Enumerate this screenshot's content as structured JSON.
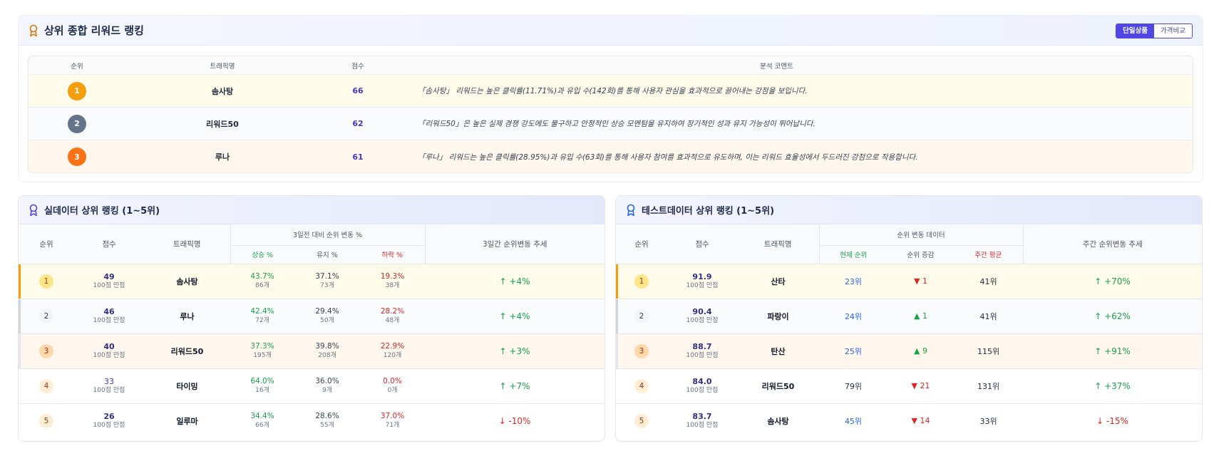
{
  "top": {
    "title": "상위 종합 리워드 랭킹",
    "toggle": [
      "단일상품",
      "가격비교"
    ],
    "headers": {
      "rank": "순위",
      "name": "트래픽명",
      "score": "점수",
      "comment": "분석 코멘트"
    },
    "rows": [
      {
        "rank": "1",
        "name": "솜사탕",
        "score": "66",
        "comment": "「솜사탕」 리워드는 높은 클릭률(11.71%)과 유입 수(142회)를 통해 사용자 관심을 효과적으로 끌어내는 강점을 보입니다."
      },
      {
        "rank": "2",
        "name": "리워드50",
        "score": "62",
        "comment": "「리워드50」은 높은 실제 경쟁 강도에도 불구하고 안정적인 상승 모멘텀을 유지하여 장기적인 성과 유지 가능성이 뛰어납니다."
      },
      {
        "rank": "3",
        "name": "루나",
        "score": "61",
        "comment": "「루나」 리워드는 높은 클릭률(28.95%)과 유입 수(63회)를 통해 사용자 참여를 효과적으로 유도하며, 이는 리워드 효율성에서 두드러진 강점으로 작용합니다."
      }
    ],
    "medal_colors": [
      "#f59e0b",
      "#64748b",
      "#f97316"
    ]
  },
  "left": {
    "title": "실데이터 상위 랭킹 (1~5위)",
    "headers": {
      "rank": "순위",
      "score": "점수",
      "name": "트래픽명",
      "group": "3일전 대비 순위 변동 %",
      "up": "상승 %",
      "keep": "유지 %",
      "down": "하락 %",
      "trend": "3일간 순위변동 추세"
    },
    "rows": [
      {
        "rank": "1",
        "score": "49",
        "score_sub": "100점 만점",
        "name": "솜사탕",
        "up": "43.7%",
        "up_cnt": "86개",
        "keep": "37.1%",
        "keep_cnt": "73개",
        "down": "19.3%",
        "down_cnt": "38개",
        "trend": "↑ +4%"
      },
      {
        "rank": "2",
        "score": "46",
        "score_sub": "100점 만점",
        "name": "루나",
        "up": "42.4%",
        "up_cnt": "72개",
        "keep": "29.4%",
        "keep_cnt": "50개",
        "down": "28.2%",
        "down_cnt": "48개",
        "trend": "↑ +4%"
      },
      {
        "rank": "3",
        "score": "40",
        "score_sub": "100점 만점",
        "name": "리워드50",
        "up": "37.3%",
        "up_cnt": "195개",
        "keep": "39.8%",
        "keep_cnt": "208개",
        "down": "22.9%",
        "down_cnt": "120개",
        "trend": "↑ +3%"
      },
      {
        "rank": "4",
        "score": "33",
        "score_sub": "100점 만점",
        "name": "타이밍",
        "up": "64.0%",
        "up_cnt": "16개",
        "keep": "36.0%",
        "keep_cnt": "9개",
        "down": "0.0%",
        "down_cnt": "0개",
        "trend": "↑ +7%"
      },
      {
        "rank": "5",
        "score": "26",
        "score_sub": "100점 만점",
        "name": "일루마",
        "up": "34.4%",
        "up_cnt": "66개",
        "keep": "28.6%",
        "keep_cnt": "55개",
        "down": "37.0%",
        "down_cnt": "71개",
        "trend": "↓ -10%"
      }
    ]
  },
  "right": {
    "title": "테스트데이터 상위 랭킹 (1~5위)",
    "headers": {
      "rank": "순위",
      "score": "점수",
      "name": "트래픽명",
      "group": "순위 변동 데이터",
      "current": "현재 순위",
      "change": "순위 증감",
      "avg": "주간 평균",
      "trend": "주간 순위변동 추세"
    },
    "rows": [
      {
        "rank": "1",
        "score": "91.9",
        "score_sub": "100점 만점",
        "name": "산타",
        "current": "23위",
        "change": "▼ 1",
        "avg": "41위",
        "trend": "↑ +70%"
      },
      {
        "rank": "2",
        "score": "90.4",
        "score_sub": "100점 만점",
        "name": "파랑이",
        "current": "24위",
        "change": "▲ 1",
        "avg": "41위",
        "trend": "↑ +62%"
      },
      {
        "rank": "3",
        "score": "88.7",
        "score_sub": "100점 만점",
        "name": "탄산",
        "current": "25위",
        "change": "▲ 9",
        "avg": "115위",
        "trend": "↑ +91%"
      },
      {
        "rank": "4",
        "score": "84.0",
        "score_sub": "100점 만점",
        "name": "리워드50",
        "current": "79위",
        "change": "▼ 21",
        "avg": "131위",
        "trend": "↑ +37%"
      },
      {
        "rank": "5",
        "score": "83.7",
        "score_sub": "100점 만점",
        "name": "솜사탕",
        "current": "45위",
        "change": "▼ 14",
        "avg": "33위",
        "trend": "↓ -15%"
      }
    ]
  }
}
